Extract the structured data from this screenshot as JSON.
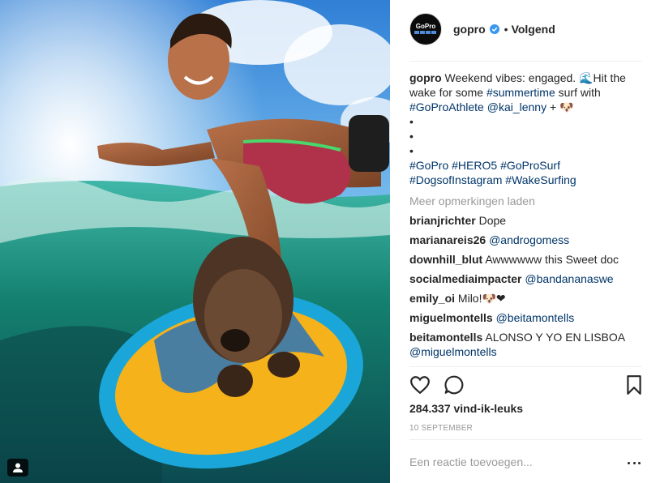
{
  "post": {
    "author": "gopro",
    "follow_status": "Volgend",
    "separator": "•",
    "caption_lines": [
      {
        "segments": [
          {
            "text": "gopro",
            "kind": "user"
          },
          {
            "text": " Weekend vibes: engaged. 🌊Hit the",
            "kind": "text"
          }
        ]
      },
      {
        "segments": [
          {
            "text": "wake for some ",
            "kind": "text"
          },
          {
            "text": "#summertime",
            "kind": "link"
          },
          {
            "text": " surf with",
            "kind": "text"
          }
        ]
      },
      {
        "segments": [
          {
            "text": "#GoProAthlete",
            "kind": "link"
          },
          {
            "text": " ",
            "kind": "text"
          },
          {
            "text": "@kai_lenny",
            "kind": "link"
          },
          {
            "text": " + 🐶",
            "kind": "text"
          }
        ]
      },
      {
        "segments": [
          {
            "text": "•",
            "kind": "text"
          }
        ]
      },
      {
        "segments": [
          {
            "text": "•",
            "kind": "text"
          }
        ]
      },
      {
        "segments": [
          {
            "text": "•",
            "kind": "text"
          }
        ]
      },
      {
        "segments": [
          {
            "text": "#GoPro",
            "kind": "link"
          },
          {
            "text": " ",
            "kind": "text"
          },
          {
            "text": "#HERO5",
            "kind": "link"
          },
          {
            "text": " ",
            "kind": "text"
          },
          {
            "text": "#GoProSurf",
            "kind": "link"
          }
        ]
      },
      {
        "segments": [
          {
            "text": "#DogsofInstagram",
            "kind": "link"
          },
          {
            "text": " ",
            "kind": "text"
          },
          {
            "text": "#WakeSurfing",
            "kind": "link"
          }
        ]
      }
    ],
    "load_more": "Meer opmerkingen laden",
    "comments": [
      {
        "user": "brianjrichter",
        "segments": [
          {
            "text": "Dope",
            "kind": "text"
          }
        ]
      },
      {
        "user": "marianareis26",
        "segments": [
          {
            "text": "@androgomess",
            "kind": "link"
          }
        ]
      },
      {
        "user": "downhill_blut",
        "segments": [
          {
            "text": "Awwwwww this Sweet doc",
            "kind": "text"
          }
        ]
      },
      {
        "user": "socialmediaimpacter",
        "segments": [
          {
            "text": "@bandananaswe",
            "kind": "link"
          }
        ]
      },
      {
        "user": "emily_oi",
        "segments": [
          {
            "text": "Milo!🐶❤",
            "kind": "text"
          }
        ]
      },
      {
        "user": "miguelmontells",
        "segments": [
          {
            "text": "@beitamontells",
            "kind": "link"
          }
        ]
      },
      {
        "user": "beitamontells",
        "segments": [
          {
            "text": "ALONSO Y YO EN LISBOA",
            "kind": "text"
          },
          {
            "text": "\n",
            "kind": "break"
          },
          {
            "text": "@miguelmontells",
            "kind": "link"
          }
        ]
      }
    ],
    "likes": "284.337 vind-ik-leuks",
    "date": "10 SEPTEMBER",
    "comment_placeholder": "Een reactie toevoegen...",
    "logo_text": "GoPro"
  },
  "colors": {
    "link": "#003569",
    "verified": "#3897f0",
    "muted": "#999999",
    "text": "#262626",
    "border": "#efefef"
  },
  "icons": {
    "like": "heart-icon",
    "comment": "speech-bubble-icon",
    "save": "bookmark-icon",
    "verified": "verified-badge-icon",
    "tag": "user-tag-icon",
    "options": "ellipsis-icon"
  }
}
